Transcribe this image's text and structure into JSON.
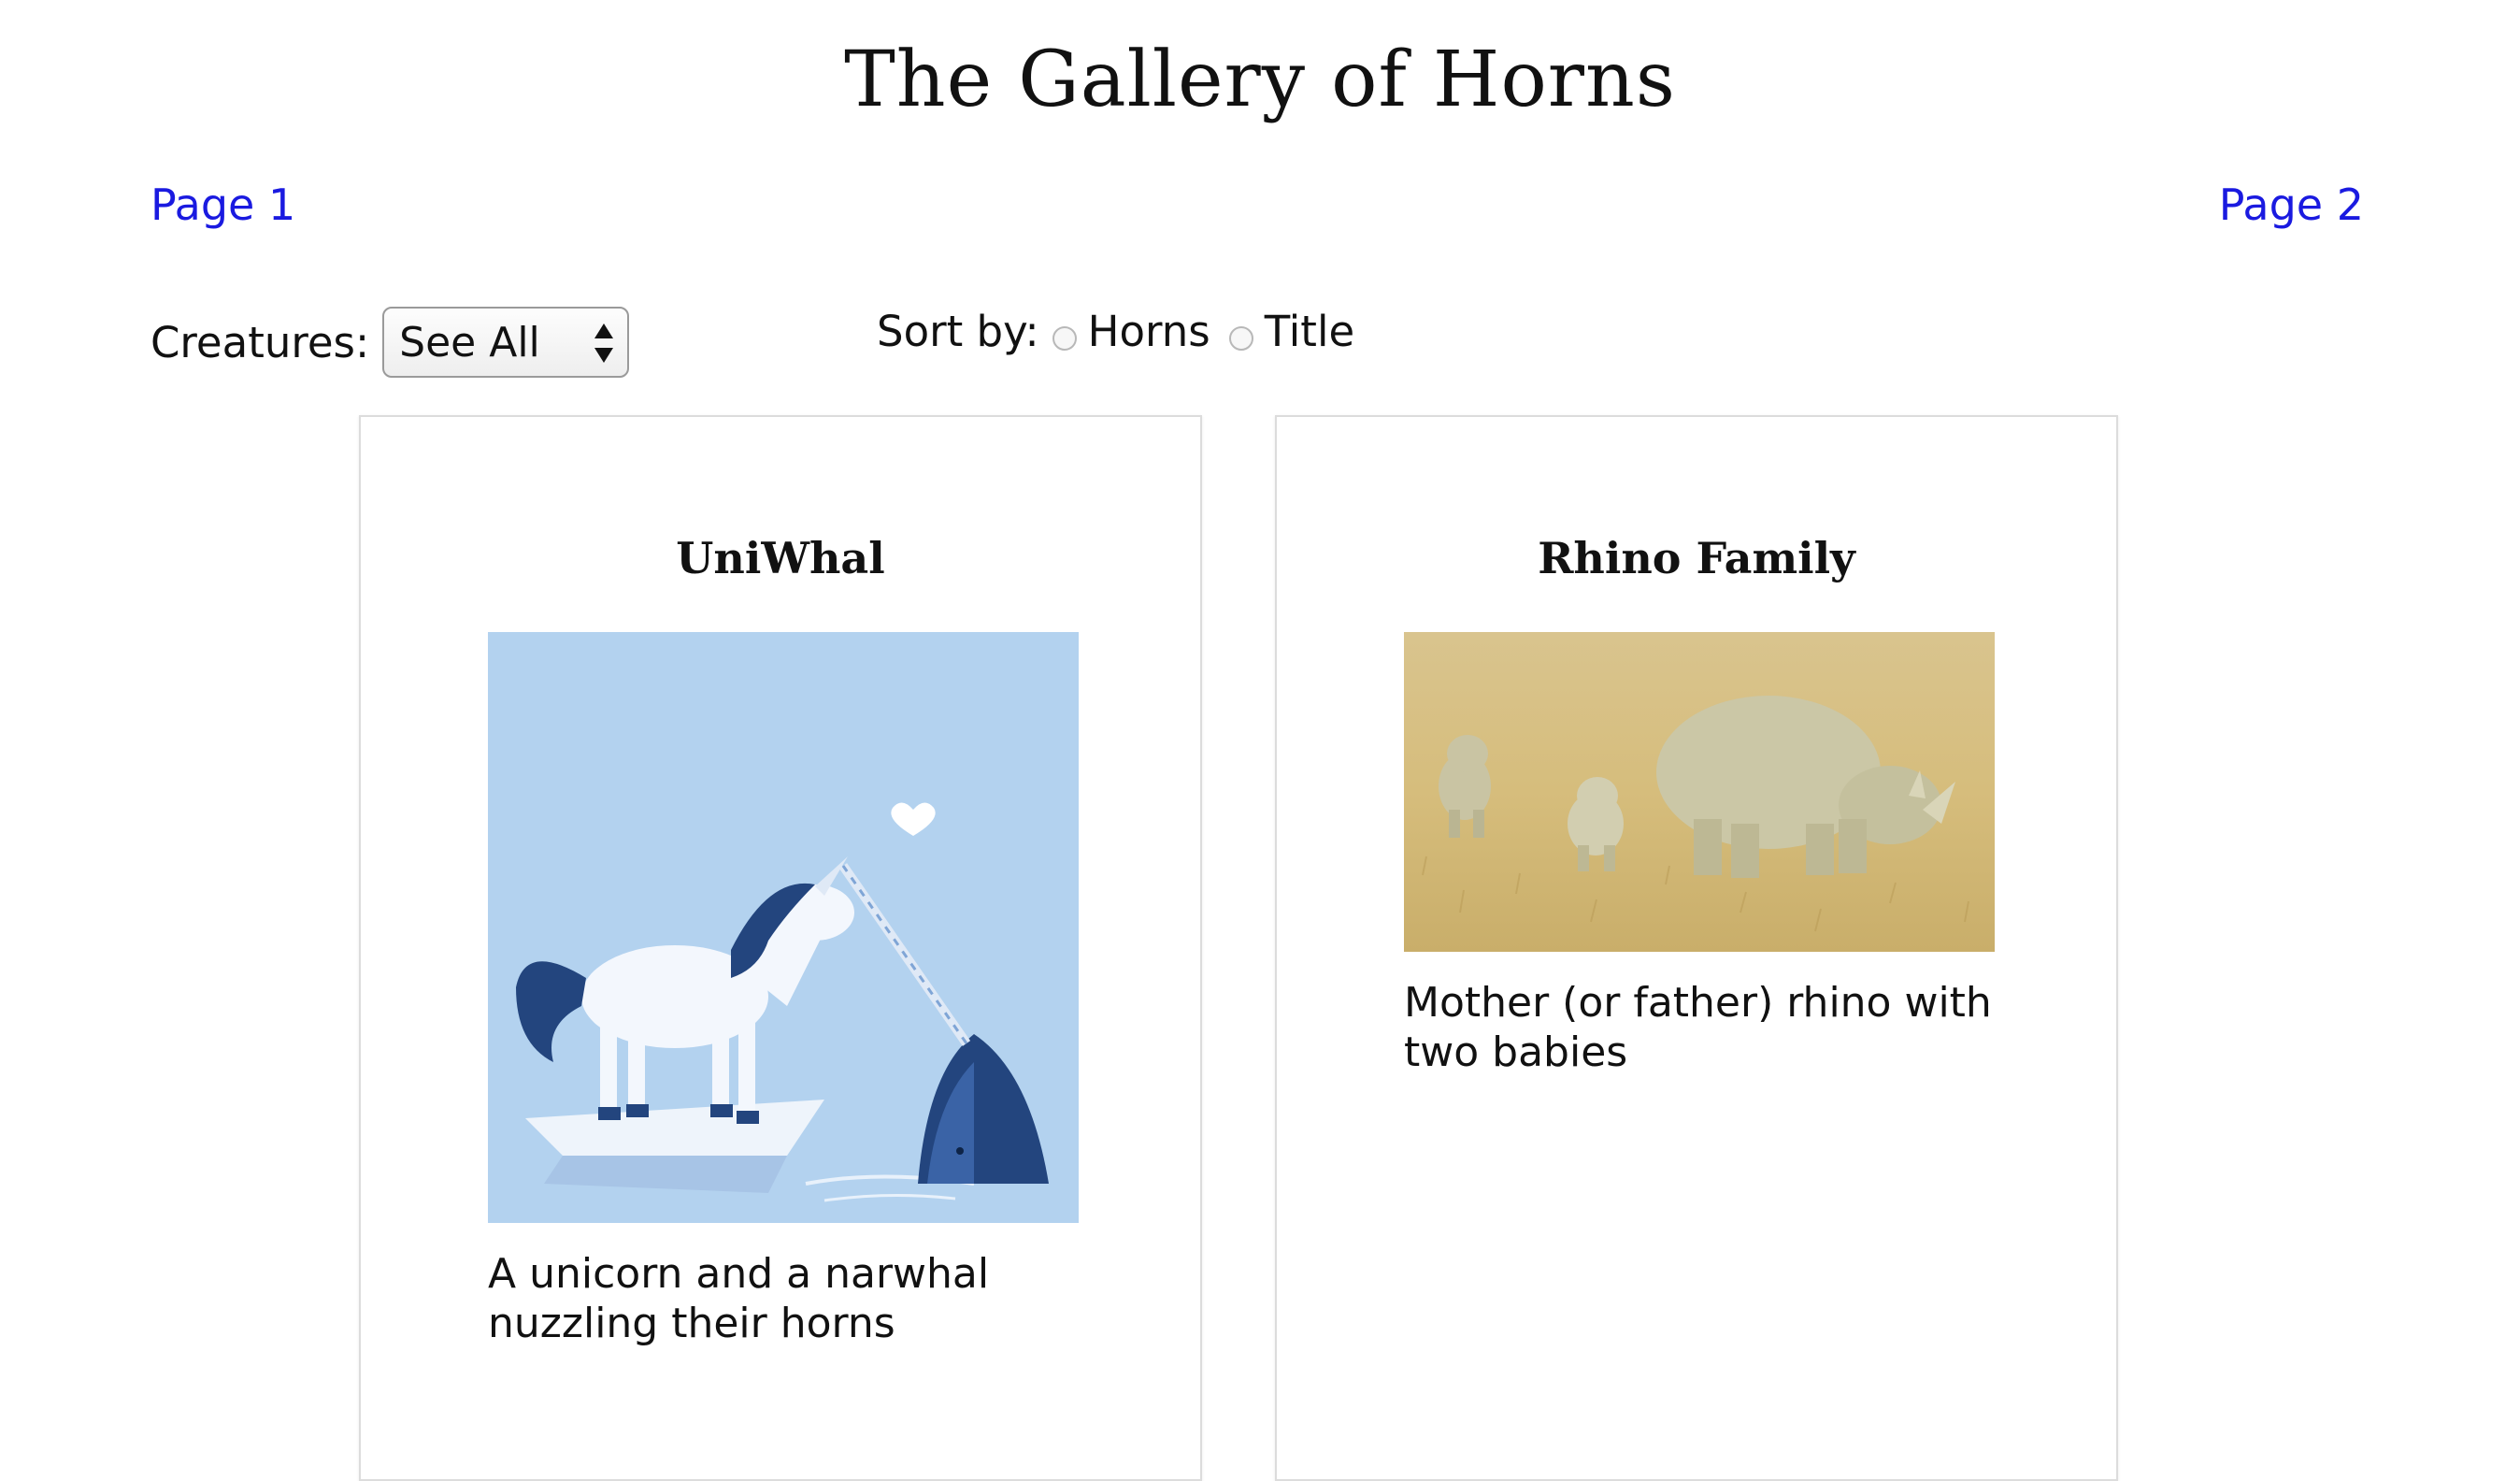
{
  "page": {
    "title": "The Gallery of Horns"
  },
  "nav": {
    "page1_label": "Page 1",
    "page2_label": "Page 2"
  },
  "filter": {
    "label": "Creatures:",
    "selected": "See All"
  },
  "sort": {
    "label": "Sort by:",
    "options": [
      "Horns",
      "Title"
    ]
  },
  "cards": [
    {
      "title": "UniWhal",
      "description": "A unicorn and a narwhal nuzzling their horns",
      "image_icon": "unicorn-narwhal-illustration"
    },
    {
      "title": "Rhino Family",
      "description": "Mother (or father) rhino with two babies",
      "image_icon": "rhino-family-photo"
    }
  ],
  "colors": {
    "link": "#1a1ae0",
    "card_border": "#dcdcdc",
    "uniwhal_bg": "#b3d2ef"
  }
}
